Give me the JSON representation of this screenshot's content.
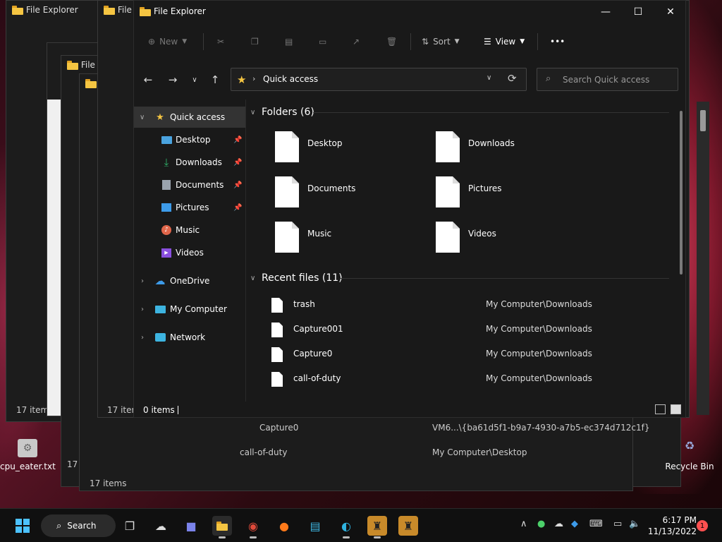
{
  "window": {
    "title": "File Explorer",
    "minimize": "—",
    "maximize": "☐",
    "close": "✕"
  },
  "toolbar": {
    "new_label": "New",
    "sort_label": "Sort",
    "view_label": "View",
    "more_label": "•••"
  },
  "address": {
    "path": "Quick access",
    "separator": "›"
  },
  "search": {
    "placeholder": "Search Quick access"
  },
  "nav": {
    "items": [
      {
        "label": "Quick access",
        "icon": "star-icon",
        "color": "#f5c542"
      },
      {
        "label": "Desktop",
        "icon": "desktop-icon",
        "color": "#4aa3df",
        "pinned": true
      },
      {
        "label": "Downloads",
        "icon": "download-icon",
        "color": "#2fb36b",
        "pinned": true
      },
      {
        "label": "Documents",
        "icon": "document-icon",
        "color": "#9aa3ad",
        "pinned": true
      },
      {
        "label": "Pictures",
        "icon": "pictures-icon",
        "color": "#3d9be9",
        "pinned": true
      },
      {
        "label": "Music",
        "icon": "music-icon",
        "color": "#e0664a"
      },
      {
        "label": "Videos",
        "icon": "videos-icon",
        "color": "#8a4fe0"
      },
      {
        "label": "OneDrive",
        "icon": "onedrive-icon",
        "color": "#3d9be9"
      },
      {
        "label": "My Computer",
        "icon": "computer-icon",
        "color": "#3db4e0"
      },
      {
        "label": "Network",
        "icon": "network-icon",
        "color": "#3db4e0"
      }
    ]
  },
  "folders": {
    "title": "Folders (6)",
    "items": [
      "Desktop",
      "Downloads",
      "Documents",
      "Pictures",
      "Music",
      "Videos"
    ]
  },
  "recent": {
    "title": "Recent files (11)",
    "items": [
      {
        "name": "trash",
        "location": "My Computer\\Downloads"
      },
      {
        "name": "Capture001",
        "location": "My Computer\\Downloads"
      },
      {
        "name": "Capture0",
        "location": "My Computer\\Downloads"
      },
      {
        "name": "call-of-duty",
        "location": "My Computer\\Downloads"
      }
    ]
  },
  "status": {
    "count": "0 items"
  },
  "background": {
    "title_partial": "File",
    "status_17": "17 items",
    "status_17_short": "17 item",
    "status_17_num": "17",
    "status_0_short": "0 it",
    "rows": [
      {
        "name": "Capture0",
        "location": "VM6...\\{ba61d5f1-b9a7-4930-a7b5-ec374d712c1f}"
      },
      {
        "name": "call-of-duty",
        "location": "My Computer\\Desktop"
      }
    ]
  },
  "desktop": {
    "icons": [
      {
        "label": "cpu_eater.txt"
      },
      {
        "label": "Recycle Bin"
      }
    ]
  },
  "taskbar": {
    "search_label": "Search",
    "time": "6:17 PM",
    "date": "11/13/2022",
    "notifications": "1"
  }
}
